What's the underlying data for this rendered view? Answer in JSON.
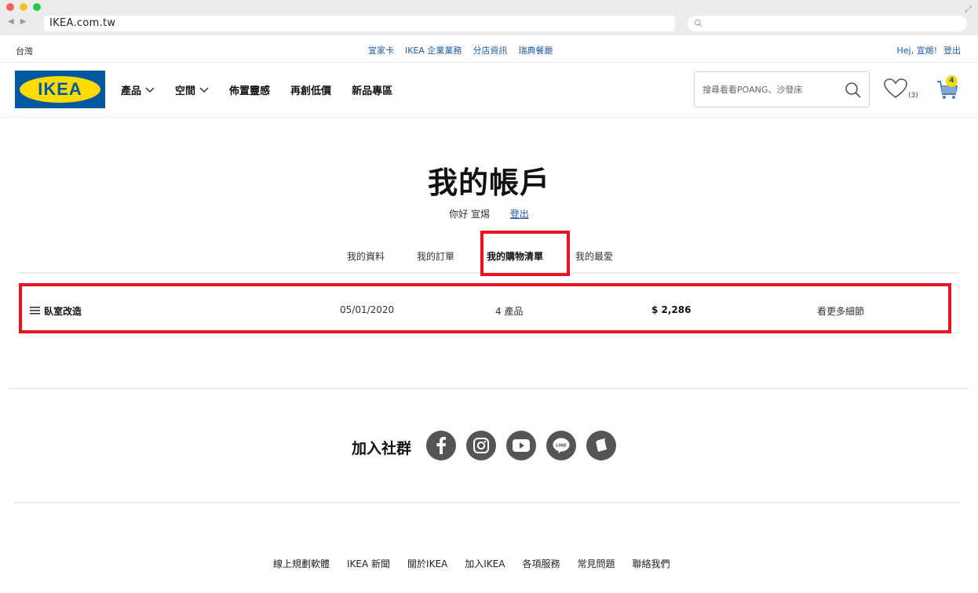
{
  "browser": {
    "url": "IKEA.com.tw",
    "back_glyph": "◀",
    "forward_glyph": "▶",
    "expand_glyph": "⤢"
  },
  "util": {
    "country": "台灣",
    "links": [
      "宜家卡",
      "IKEA 企業業務",
      "分店資訊",
      "瑞典餐廳"
    ],
    "greeting": "Hej, 宣焬!",
    "logout": "登出"
  },
  "header": {
    "logo_text": "IKEA",
    "nav": [
      {
        "label": "產品",
        "dropdown": true
      },
      {
        "label": "空間",
        "dropdown": true
      },
      {
        "label": "佈置靈感",
        "dropdown": false
      },
      {
        "label": "再創低價",
        "dropdown": false
      },
      {
        "label": "新品專區",
        "dropdown": false
      }
    ],
    "search_placeholder": "搜尋看看POANG、沙發床",
    "wishlist_count": "(3)",
    "cart_count": "4"
  },
  "account": {
    "title": "我的帳戶",
    "hello": "你好 宣焬",
    "logout": "登出",
    "tabs": [
      "我的資料",
      "我的訂單",
      "我的購物清單",
      "我的最愛"
    ],
    "active_tab": "我的購物清單"
  },
  "shopping_list": {
    "name": "臥室改造",
    "date": "05/01/2020",
    "count": "4 產品",
    "price": "$ 2,286",
    "more": "看更多細節"
  },
  "social": {
    "label": "加入社群",
    "icons": [
      "facebook-icon",
      "instagram-icon",
      "youtube-icon",
      "line-icon",
      "blog-icon"
    ]
  },
  "footer": {
    "links": [
      "線上規劃軟體",
      "IKEA 新聞",
      "關於IKEA",
      "加入IKEA",
      "各項服務",
      "常見問題",
      "聯絡我們"
    ]
  },
  "colors": {
    "ikea_blue": "#0058a3",
    "ikea_yellow": "#ffdb00",
    "link_blue": "#1d5aa8",
    "highlight_red": "#e8141e"
  }
}
